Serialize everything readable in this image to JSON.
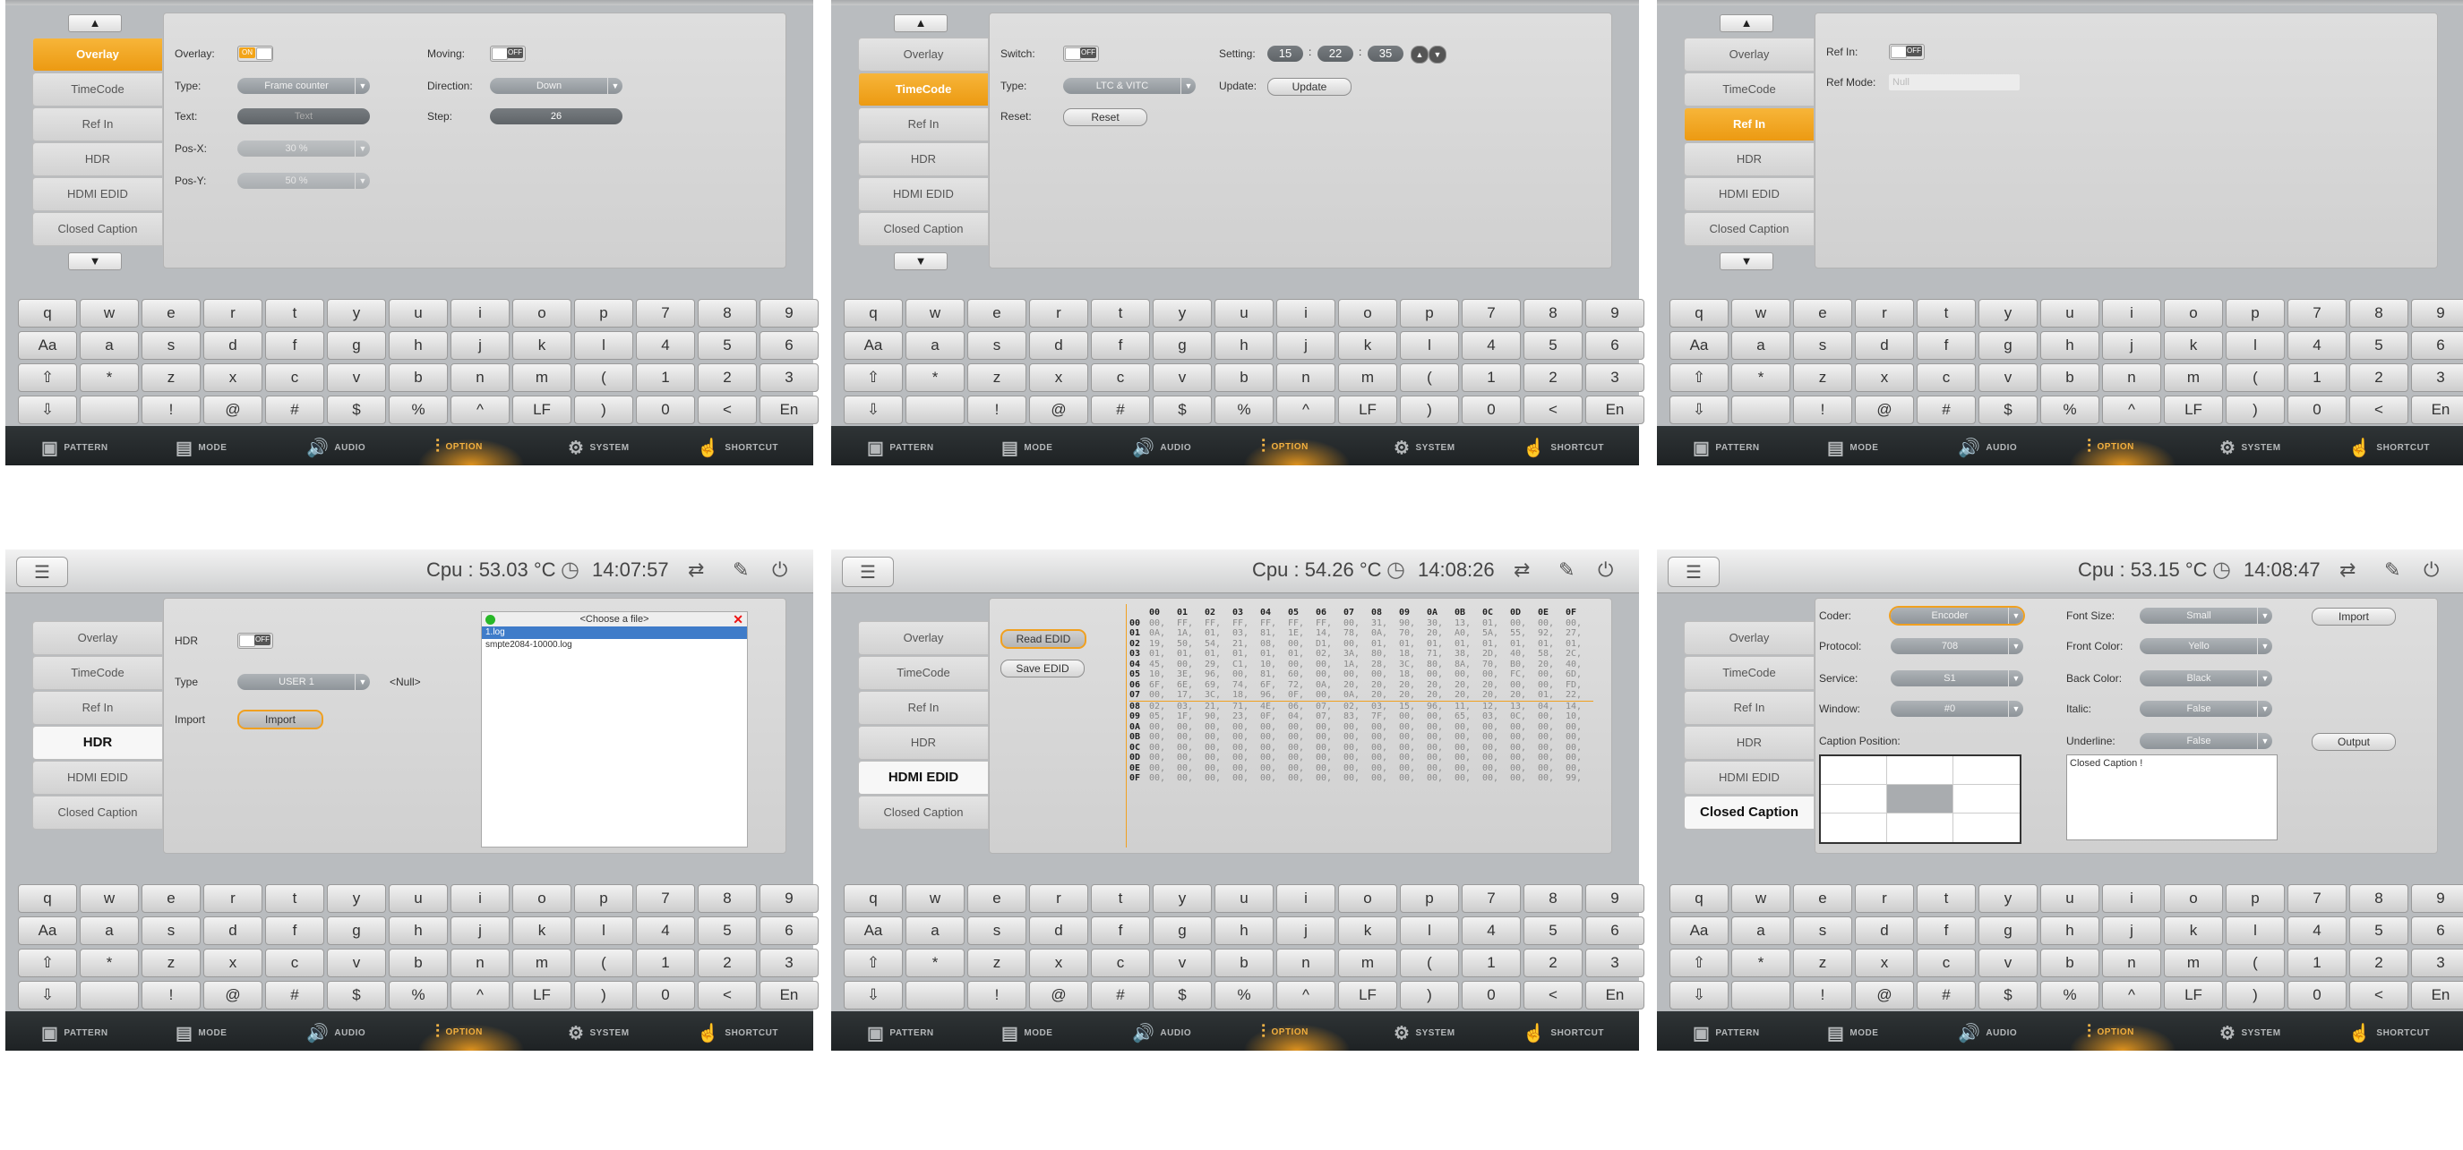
{
  "keyboard": {
    "rows": [
      [
        "q",
        "w",
        "e",
        "r",
        "t",
        "y",
        "u",
        "i",
        "o",
        "p",
        "7",
        "8",
        "9"
      ],
      [
        "Aa",
        "a",
        "s",
        "d",
        "f",
        "g",
        "h",
        "j",
        "k",
        "l",
        "4",
        "5",
        "6"
      ],
      [
        "⇧",
        "*",
        "z",
        "x",
        "c",
        "v",
        "b",
        "n",
        "m",
        "(",
        "1",
        "2",
        "3"
      ],
      [
        "⇩",
        "",
        "!",
        "@",
        "#",
        "$",
        "%",
        "^",
        "LF",
        ")",
        "0",
        "<",
        "En"
      ]
    ]
  },
  "bottom_bar": {
    "items": [
      "PATTERN",
      "MODE",
      "AUDIO",
      "OPTION",
      "SYSTEM",
      "SHORTCUT"
    ],
    "active": "OPTION",
    "accent": "#f3a418"
  },
  "nav_items": [
    "Overlay",
    "TimeCode",
    "Ref In",
    "HDR",
    "HDMI EDID",
    "Closed Caption"
  ],
  "panels": [
    {
      "active": "Overlay",
      "fields": {
        "overlay_label": "Overlay:",
        "overlay_on": "ON",
        "type_label": "Type:",
        "type_value": "Frame counter",
        "text_label": "Text:",
        "text_value": "Text",
        "posx_label": "Pos-X:",
        "posx_value": "30 %",
        "posy_label": "Pos-Y:",
        "posy_value": "50 %",
        "moving_label": "Moving:",
        "moving_value": "OFF",
        "direction_label": "Direction:",
        "direction_value": "Down",
        "step_label": "Step:",
        "step_value": "26"
      }
    },
    {
      "active": "TimeCode",
      "fields": {
        "switch_label": "Switch:",
        "switch_value": "OFF",
        "type_label": "Type:",
        "type_value": "LTC & VITC",
        "reset_label": "Reset:",
        "reset_btn": "Reset",
        "setting_label": "Setting:",
        "hh": "15",
        "mm": "22",
        "ss": "35",
        "update_label": "Update:",
        "update_btn": "Update"
      }
    },
    {
      "active": "Ref In",
      "fields": {
        "refin_label": "Ref In:",
        "refin_value": "OFF",
        "refmode_label": "Ref Mode:",
        "refmode_value": "Null"
      }
    },
    {
      "active": "HDR",
      "cpu": "Cpu : 53.03 °C",
      "time": "14:07:57",
      "fields": {
        "hdr_label": "HDR",
        "hdr_value": "OFF",
        "type_label": "Type",
        "type_value": "USER 1",
        "null_text": "<Null>",
        "import_label": "Import",
        "import_btn": "Import",
        "file_title": "<Choose a file>",
        "files": [
          "1.log",
          "smpte2084-10000.log"
        ]
      }
    },
    {
      "active": "HDMI EDID",
      "cpu": "Cpu : 54.26 °C",
      "time": "14:08:26",
      "fields": {
        "read_btn": "Read EDID",
        "save_btn": "Save EDID"
      },
      "edid_cols": [
        "00",
        "01",
        "02",
        "03",
        "04",
        "05",
        "06",
        "07",
        "08",
        "09",
        "0A",
        "0B",
        "0C",
        "0D",
        "0E",
        "0F"
      ],
      "edid_rows": [
        [
          "00",
          "00,",
          "FF,",
          "FF,",
          "FF,",
          "FF,",
          "FF,",
          "FF,",
          "00,",
          "31,",
          "90,",
          "30,",
          "13,",
          "01,",
          "00,",
          "00,",
          "00,"
        ],
        [
          "01",
          "0A,",
          "1A,",
          "01,",
          "03,",
          "81,",
          "1E,",
          "14,",
          "78,",
          "0A,",
          "70,",
          "20,",
          "A0,",
          "5A,",
          "55,",
          "92,",
          "27,"
        ],
        [
          "02",
          "19,",
          "50,",
          "54,",
          "21,",
          "08,",
          "00,",
          "D1,",
          "00,",
          "01,",
          "01,",
          "01,",
          "01,",
          "01,",
          "01,",
          "01,",
          "01,"
        ],
        [
          "03",
          "01,",
          "01,",
          "01,",
          "01,",
          "01,",
          "01,",
          "02,",
          "3A,",
          "80,",
          "18,",
          "71,",
          "38,",
          "2D,",
          "40,",
          "58,",
          "2C,"
        ],
        [
          "04",
          "45,",
          "00,",
          "29,",
          "C1,",
          "10,",
          "00,",
          "00,",
          "1A,",
          "28,",
          "3C,",
          "80,",
          "8A,",
          "70,",
          "B0,",
          "20,",
          "40,"
        ],
        [
          "05",
          "10,",
          "3E,",
          "96,",
          "00,",
          "81,",
          "60,",
          "00,",
          "00,",
          "00,",
          "18,",
          "00,",
          "00,",
          "00,",
          "FC,",
          "00,",
          "6D,"
        ],
        [
          "06",
          "6F,",
          "6E,",
          "69,",
          "74,",
          "6F,",
          "72,",
          "0A,",
          "20,",
          "20,",
          "20,",
          "20,",
          "20,",
          "20,",
          "00,",
          "00,",
          "FD,"
        ],
        [
          "07",
          "00,",
          "17,",
          "3C,",
          "18,",
          "96,",
          "0F,",
          "00,",
          "0A,",
          "20,",
          "20,",
          "20,",
          "20,",
          "20,",
          "20,",
          "01,",
          "22,"
        ],
        [
          "08",
          "02,",
          "03,",
          "21,",
          "71,",
          "4E,",
          "06,",
          "07,",
          "02,",
          "03,",
          "15,",
          "96,",
          "11,",
          "12,",
          "13,",
          "04,",
          "14,"
        ],
        [
          "09",
          "05,",
          "1F,",
          "90,",
          "23,",
          "0F,",
          "04,",
          "07,",
          "83,",
          "7F,",
          "00,",
          "00,",
          "65,",
          "03,",
          "0C,",
          "00,",
          "10,"
        ],
        [
          "0A",
          "00,",
          "00,",
          "00,",
          "00,",
          "00,",
          "00,",
          "00,",
          "00,",
          "00,",
          "00,",
          "00,",
          "00,",
          "00,",
          "00,",
          "00,",
          "00,"
        ],
        [
          "0B",
          "00,",
          "00,",
          "00,",
          "00,",
          "00,",
          "00,",
          "00,",
          "00,",
          "00,",
          "00,",
          "00,",
          "00,",
          "00,",
          "00,",
          "00,",
          "00,"
        ],
        [
          "0C",
          "00,",
          "00,",
          "00,",
          "00,",
          "00,",
          "00,",
          "00,",
          "00,",
          "00,",
          "00,",
          "00,",
          "00,",
          "00,",
          "00,",
          "00,",
          "00,"
        ],
        [
          "0D",
          "00,",
          "00,",
          "00,",
          "00,",
          "00,",
          "00,",
          "00,",
          "00,",
          "00,",
          "00,",
          "00,",
          "00,",
          "00,",
          "00,",
          "00,",
          "00,"
        ],
        [
          "0E",
          "00,",
          "00,",
          "00,",
          "00,",
          "00,",
          "00,",
          "00,",
          "00,",
          "00,",
          "00,",
          "00,",
          "00,",
          "00,",
          "00,",
          "00,",
          "00,"
        ],
        [
          "0F",
          "00,",
          "00,",
          "00,",
          "00,",
          "00,",
          "00,",
          "00,",
          "00,",
          "00,",
          "00,",
          "00,",
          "00,",
          "00,",
          "00,",
          "00,",
          "99,"
        ]
      ]
    },
    {
      "active": "Closed Caption",
      "cpu": "Cpu : 53.15 °C",
      "time": "14:08:47",
      "fields": {
        "coder_label": "Coder:",
        "coder_value": "Encoder",
        "protocol_label": "Protocol:",
        "protocol_value": "708",
        "service_label": "Service:",
        "service_value": "S1",
        "window_label": "Window:",
        "window_value": "#0",
        "pos_label": "Caption Position:",
        "fontsize_label": "Font Size:",
        "fontsize_value": "Small",
        "frontcolor_label": "Front Color:",
        "frontcolor_value": "Yello",
        "backcolor_label": "Back Color:",
        "backcolor_value": "Black",
        "italic_label": "Italic:",
        "italic_value": "False",
        "underline_label": "Underline:",
        "underline_value": "False",
        "import_btn": "Import",
        "output_btn": "Output",
        "caption_text": "Closed Caption !"
      }
    }
  ]
}
